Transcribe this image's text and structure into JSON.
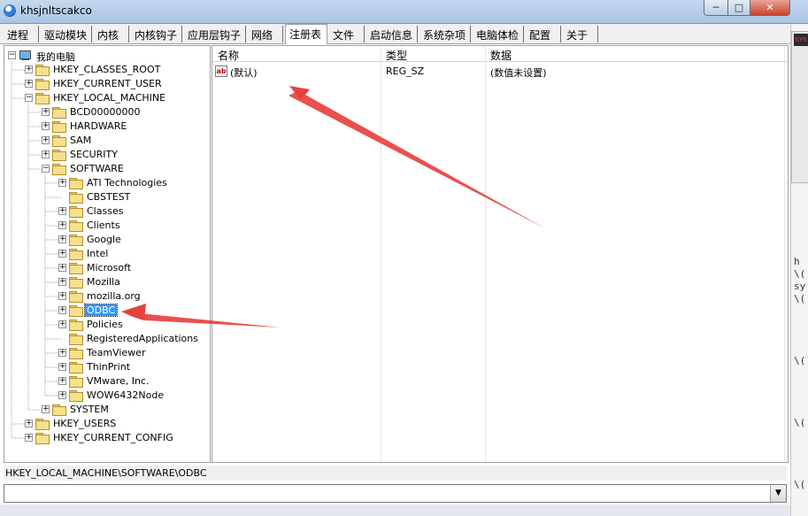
{
  "window": {
    "title": "khsjnltscakco",
    "min_glyph": "─",
    "max_glyph": "□",
    "close_glyph": "✕"
  },
  "tabs": [
    {
      "label": "进程"
    },
    {
      "label": "驱动模块"
    },
    {
      "label": "内核"
    },
    {
      "label": "内核钩子"
    },
    {
      "label": "应用层钩子"
    },
    {
      "label": "网络"
    },
    {
      "label": "注册表",
      "active": true
    },
    {
      "label": "文件"
    },
    {
      "label": "启动信息"
    },
    {
      "label": "系统杂项"
    },
    {
      "label": "电脑体检"
    },
    {
      "label": "配置"
    },
    {
      "label": "关于"
    }
  ],
  "tree": [
    {
      "label": "我的电脑",
      "level": 0,
      "expander": "−",
      "icon": "computer"
    },
    {
      "label": "HKEY_CLASSES_ROOT",
      "level": 1,
      "expander": "+"
    },
    {
      "label": "HKEY_CURRENT_USER",
      "level": 1,
      "expander": "+"
    },
    {
      "label": "HKEY_LOCAL_MACHINE",
      "level": 1,
      "expander": "−"
    },
    {
      "label": "BCD00000000",
      "level": 2,
      "expander": "+"
    },
    {
      "label": "HARDWARE",
      "level": 2,
      "expander": "+"
    },
    {
      "label": "SAM",
      "level": 2,
      "expander": "+"
    },
    {
      "label": "SECURITY",
      "level": 2,
      "expander": "+"
    },
    {
      "label": "SOFTWARE",
      "level": 2,
      "expander": "−"
    },
    {
      "label": "ATI Technologies",
      "level": 3,
      "expander": "+"
    },
    {
      "label": "CBSTEST",
      "level": 3,
      "expander": ""
    },
    {
      "label": "Classes",
      "level": 3,
      "expander": "+"
    },
    {
      "label": "Clients",
      "level": 3,
      "expander": "+"
    },
    {
      "label": "Google",
      "level": 3,
      "expander": "+"
    },
    {
      "label": "Intel",
      "level": 3,
      "expander": "+"
    },
    {
      "label": "Microsoft",
      "level": 3,
      "expander": "+"
    },
    {
      "label": "Mozilla",
      "level": 3,
      "expander": "+"
    },
    {
      "label": "mozilla.org",
      "level": 3,
      "expander": "+"
    },
    {
      "label": "ODBC",
      "level": 3,
      "expander": "+",
      "selected": true
    },
    {
      "label": "Policies",
      "level": 3,
      "expander": "+"
    },
    {
      "label": "RegisteredApplications",
      "level": 3,
      "expander": ""
    },
    {
      "label": "TeamViewer",
      "level": 3,
      "expander": "+"
    },
    {
      "label": "ThinPrint",
      "level": 3,
      "expander": "+"
    },
    {
      "label": "VMware, Inc.",
      "level": 3,
      "expander": "+"
    },
    {
      "label": "WOW6432Node",
      "level": 3,
      "expander": "+"
    },
    {
      "label": "SYSTEM",
      "level": 2,
      "expander": "+"
    },
    {
      "label": "HKEY_USERS",
      "level": 1,
      "expander": "+"
    },
    {
      "label": "HKEY_CURRENT_CONFIG",
      "level": 1,
      "expander": "+"
    }
  ],
  "list": {
    "columns": [
      {
        "label": "名称"
      },
      {
        "label": "类型"
      },
      {
        "label": "数据"
      }
    ],
    "rows": [
      {
        "icon_text": "ab",
        "name": "(默认)",
        "type": "REG_SZ",
        "data": "(数值未设置)"
      }
    ]
  },
  "status": {
    "path": "HKEY_LOCAL_MACHINE\\SOFTWARE\\ODBC"
  },
  "combo": {
    "value": "",
    "arrow": "▼"
  },
  "background": {
    "sys_label": "SYS",
    "text_lines": [
      "h",
      "\\(",
      "sy",
      "\\(",
      "\\(",
      "\\(",
      "\\("
    ]
  },
  "colors": {
    "selection": "#3399ff",
    "arrow": "#e8413d"
  }
}
